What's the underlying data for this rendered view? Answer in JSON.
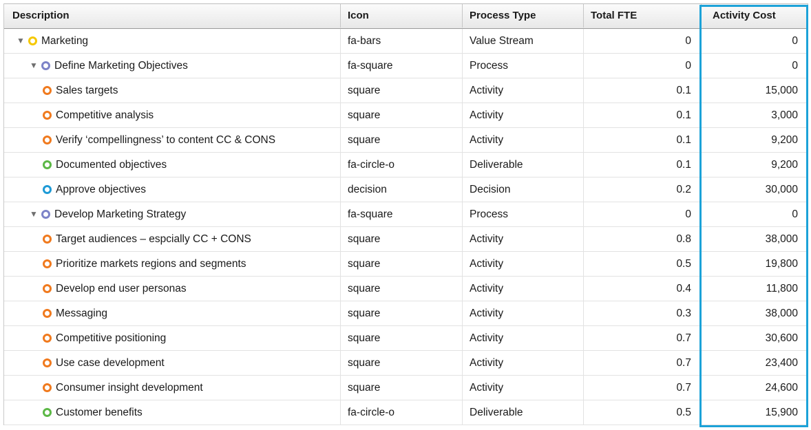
{
  "columns": {
    "description": "Description",
    "icon": "Icon",
    "process_type": "Process Type",
    "total_fte": "Total FTE",
    "activity_cost": "Activity Cost"
  },
  "colors": {
    "value_stream": "#f5c800",
    "process": "#7d83c8",
    "activity": "#f07a1e",
    "deliverable": "#5cb846",
    "decision": "#1e9ad6",
    "highlight": "#1ca2d8"
  },
  "rows": [
    {
      "description": "Marketing",
      "level": 0,
      "expander": "▼",
      "kind": "value_stream",
      "icon": "fa-bars",
      "process_type": "Value Stream",
      "total_fte": "0",
      "activity_cost": "0"
    },
    {
      "description": "Define Marketing Objectives",
      "level": 1,
      "expander": "▼",
      "kind": "process",
      "icon": "fa-square",
      "process_type": "Process",
      "total_fte": "0",
      "activity_cost": "0"
    },
    {
      "description": "Sales targets",
      "level": 2,
      "expander": "",
      "kind": "activity",
      "icon": "square",
      "process_type": "Activity",
      "total_fte": "0.1",
      "activity_cost": "15,000"
    },
    {
      "description": "Competitive analysis",
      "level": 2,
      "expander": "",
      "kind": "activity",
      "icon": "square",
      "process_type": "Activity",
      "total_fte": "0.1",
      "activity_cost": "3,000"
    },
    {
      "description": "Verify ‘compellingness’ to content CC & CONS",
      "level": 2,
      "expander": "",
      "kind": "activity",
      "icon": "square",
      "process_type": "Activity",
      "total_fte": "0.1",
      "activity_cost": "9,200"
    },
    {
      "description": "Documented objectives",
      "level": 2,
      "expander": "",
      "kind": "deliverable",
      "icon": "fa-circle-o",
      "process_type": "Deliverable",
      "total_fte": "0.1",
      "activity_cost": "9,200"
    },
    {
      "description": "Approve objectives",
      "level": 2,
      "expander": "",
      "kind": "decision",
      "icon": "decision",
      "process_type": "Decision",
      "total_fte": "0.2",
      "activity_cost": "30,000"
    },
    {
      "description": "Develop Marketing Strategy",
      "level": 1,
      "expander": "▼",
      "kind": "process",
      "icon": "fa-square",
      "process_type": "Process",
      "total_fte": "0",
      "activity_cost": "0"
    },
    {
      "description": "Target audiences – espcially CC + CONS",
      "level": 2,
      "expander": "",
      "kind": "activity",
      "icon": "square",
      "process_type": "Activity",
      "total_fte": "0.8",
      "activity_cost": "38,000"
    },
    {
      "description": "Prioritize markets regions and segments",
      "level": 2,
      "expander": "",
      "kind": "activity",
      "icon": "square",
      "process_type": "Activity",
      "total_fte": "0.5",
      "activity_cost": "19,800"
    },
    {
      "description": "Develop end user personas",
      "level": 2,
      "expander": "",
      "kind": "activity",
      "icon": "square",
      "process_type": "Activity",
      "total_fte": "0.4",
      "activity_cost": "11,800"
    },
    {
      "description": "Messaging",
      "level": 2,
      "expander": "",
      "kind": "activity",
      "icon": "square",
      "process_type": "Activity",
      "total_fte": "0.3",
      "activity_cost": "38,000"
    },
    {
      "description": "Competitive positioning",
      "level": 2,
      "expander": "",
      "kind": "activity",
      "icon": "square",
      "process_type": "Activity",
      "total_fte": "0.7",
      "activity_cost": "30,600"
    },
    {
      "description": "Use case development",
      "level": 2,
      "expander": "",
      "kind": "activity",
      "icon": "square",
      "process_type": "Activity",
      "total_fte": "0.7",
      "activity_cost": "23,400"
    },
    {
      "description": "Consumer insight development",
      "level": 2,
      "expander": "",
      "kind": "activity",
      "icon": "square",
      "process_type": "Activity",
      "total_fte": "0.7",
      "activity_cost": "24,600"
    },
    {
      "description": "Customer benefits",
      "level": 2,
      "expander": "",
      "kind": "deliverable",
      "icon": "fa-circle-o",
      "process_type": "Deliverable",
      "total_fte": "0.5",
      "activity_cost": "15,900"
    }
  ]
}
